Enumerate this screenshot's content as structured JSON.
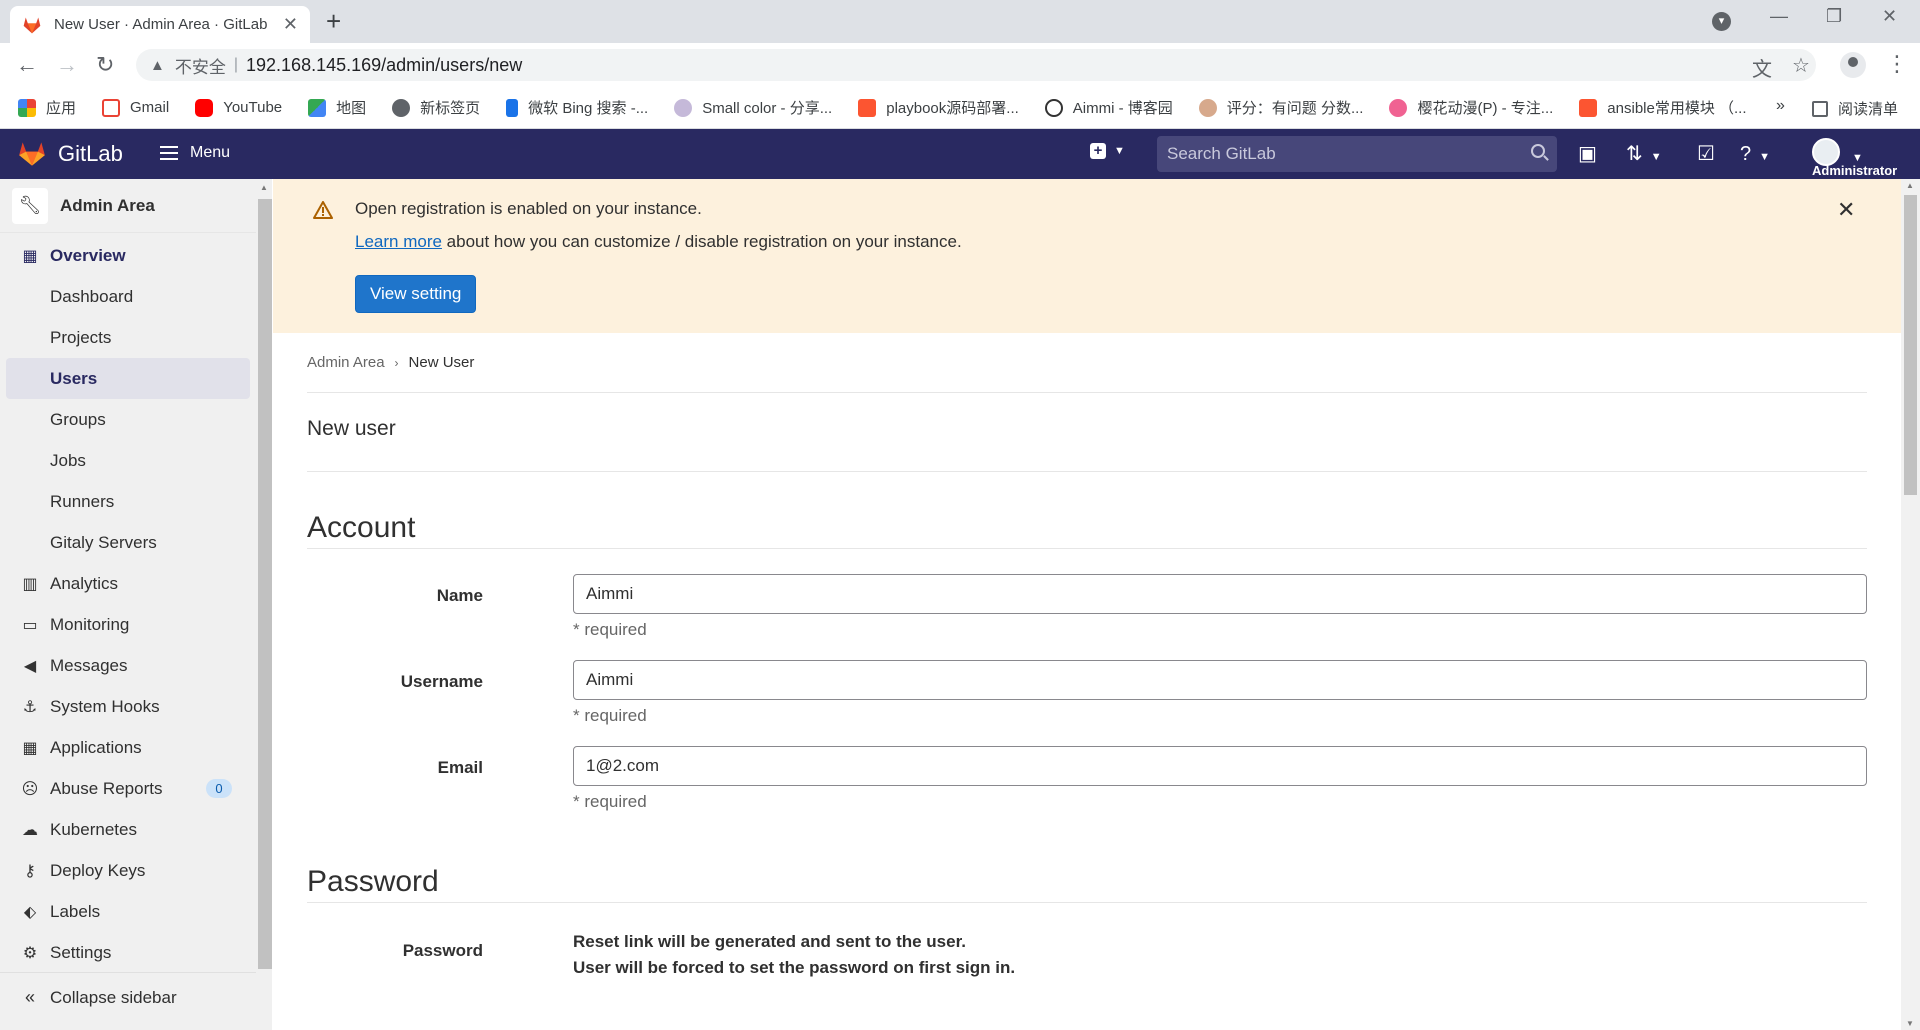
{
  "browser": {
    "tab_title": "New User · Admin Area · GitLab",
    "url": "192.168.145.169/admin/users/new",
    "insecure_label": "不安全",
    "bookmarks": [
      {
        "label": "应用"
      },
      {
        "label": "Gmail"
      },
      {
        "label": "YouTube"
      },
      {
        "label": "地图"
      },
      {
        "label": "新标签页"
      },
      {
        "label": "微软 Bing 搜索 -..."
      },
      {
        "label": "Small color - 分享..."
      },
      {
        "label": "playbook源码部署..."
      },
      {
        "label": "Aimmi - 博客园"
      },
      {
        "label": "评分：有问题 分数..."
      },
      {
        "label": "樱花动漫(P) - 专注..."
      },
      {
        "label": "ansible常用模块 （..."
      }
    ],
    "more_bookmarks": "»",
    "reading_list": "阅读清单"
  },
  "header": {
    "brand": "GitLab",
    "menu_label": "Menu",
    "search_placeholder": "Search GitLab",
    "user_name": "Administrator"
  },
  "sidebar": {
    "context_title": "Admin Area",
    "overview": "Overview",
    "overview_items": [
      "Dashboard",
      "Projects",
      "Users",
      "Groups",
      "Jobs",
      "Runners",
      "Gitaly Servers"
    ],
    "items": [
      {
        "label": "Analytics",
        "icon": "chart-icon"
      },
      {
        "label": "Monitoring",
        "icon": "monitor-icon"
      },
      {
        "label": "Messages",
        "icon": "bullhorn-icon"
      },
      {
        "label": "System Hooks",
        "icon": "hook-icon"
      },
      {
        "label": "Applications",
        "icon": "grid-icon"
      },
      {
        "label": "Abuse Reports",
        "icon": "sad-face-icon"
      },
      {
        "label": "Kubernetes",
        "icon": "cloud-gear-icon"
      },
      {
        "label": "Deploy Keys",
        "icon": "key-icon"
      },
      {
        "label": "Labels",
        "icon": "label-icon"
      },
      {
        "label": "Settings",
        "icon": "gear-icon"
      }
    ],
    "abuse_count": "0",
    "collapse": "Collapse sidebar"
  },
  "alert": {
    "title": "Open registration is enabled on your instance.",
    "link": "Learn more",
    "body": " about how you can customize / disable registration on your instance.",
    "button": "View setting",
    "close": "✕"
  },
  "breadcrumb": {
    "parent": "Admin Area",
    "current": "New User"
  },
  "page_title": "New user",
  "account": {
    "title": "Account",
    "name_label": "Name",
    "name_value": "Aimmi",
    "username_label": "Username",
    "username_value": "Aimmi",
    "email_label": "Email",
    "email_value": "1@2.com",
    "required": "* required"
  },
  "password": {
    "title": "Password",
    "label": "Password",
    "line1": "Reset link will be generated and sent to the user.",
    "line2": "User will be forced to set the password on first sign in."
  },
  "colors": {
    "header_bg": "#292961",
    "alert_bg": "#fdf1dd",
    "primary": "#1f75cb"
  }
}
